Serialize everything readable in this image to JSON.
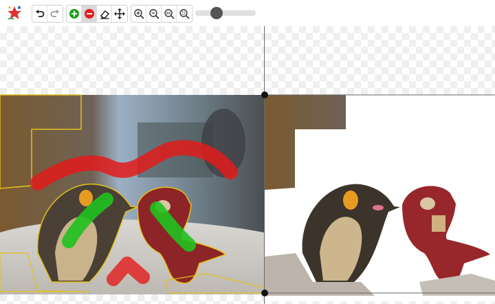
{
  "app": {
    "logo_icon": "star-logo-icon"
  },
  "toolbar": {
    "history": [
      {
        "name": "undo-button",
        "icon": "undo-icon"
      },
      {
        "name": "redo-button",
        "icon": "redo-icon"
      }
    ],
    "tools": [
      {
        "name": "add-mask-button",
        "icon": "plus-circle-icon",
        "color": "#1aa31a"
      },
      {
        "name": "remove-mask-button",
        "icon": "minus-circle-icon",
        "color": "#e02020",
        "active": true
      },
      {
        "name": "eraser-button",
        "icon": "eraser-icon"
      },
      {
        "name": "move-button",
        "icon": "move-arrows-icon"
      }
    ],
    "zoom": [
      {
        "name": "zoom-in-button",
        "icon": "zoom-in-icon"
      },
      {
        "name": "zoom-out-button",
        "icon": "zoom-out-icon"
      },
      {
        "name": "zoom-actual-button",
        "icon": "zoom-1to1-icon"
      },
      {
        "name": "zoom-fit-button",
        "icon": "zoom-fit-icon"
      }
    ],
    "brush_size_slider": {
      "level": 0.32
    }
  },
  "colors": {
    "add_stroke": "#1fc21f",
    "remove_stroke": "#e21b1b",
    "mask_outline": "#e2c21a",
    "checker": "#efefef"
  }
}
